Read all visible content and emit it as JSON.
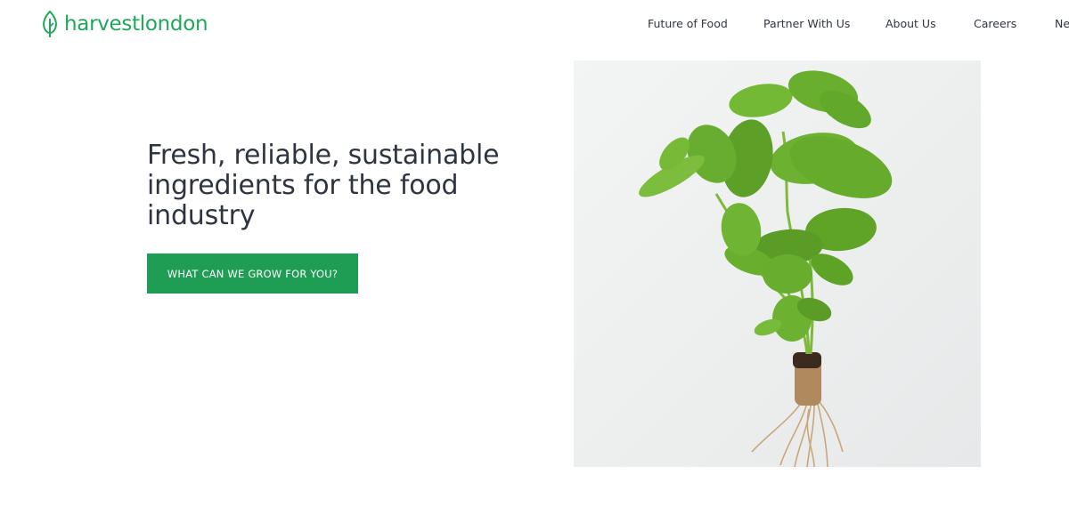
{
  "brand": {
    "name": "harvestlondon",
    "color": "#1fa85c"
  },
  "nav": {
    "items": [
      {
        "label": "Future of Food"
      },
      {
        "label": "Partner With Us"
      },
      {
        "label": "About Us"
      },
      {
        "label": "Careers"
      },
      {
        "label": "Ne"
      }
    ]
  },
  "hero": {
    "headline": "Fresh, reliable, sustainable ingredients for the food industry",
    "cta_label": "WHAT CAN WE GROW FOR YOU?",
    "cta_color": "#1f9d55",
    "image": "basil-plant-photo"
  }
}
